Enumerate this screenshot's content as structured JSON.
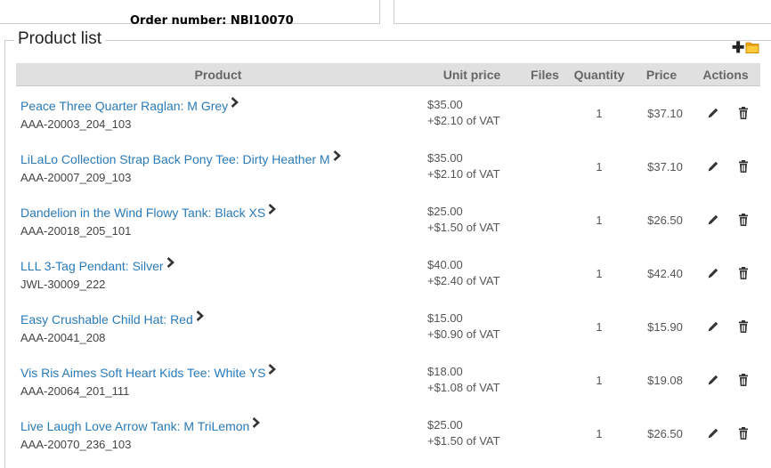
{
  "order": {
    "number_label": "Order number: NBI10070"
  },
  "section": {
    "legend": "Product list"
  },
  "toolbar": {
    "add_icon": "plus-icon",
    "folder_icon": "folder-icon",
    "folder_color": "#f0a800"
  },
  "table": {
    "headers": {
      "product": "Product",
      "unit_price": "Unit price",
      "files": "Files",
      "quantity": "Quantity",
      "price": "Price",
      "actions": "Actions"
    },
    "rows": [
      {
        "name": "Peace Three Quarter Raglan: M Grey",
        "sku": "AAA-20003_204_103",
        "unit_price": "$35.00",
        "vat": "+$2.10 of VAT",
        "quantity": "1",
        "price": "$37.10"
      },
      {
        "name": "LiLaLo Collection Strap Back Pony Tee: Dirty Heather M",
        "sku": "AAA-20007_209_103",
        "unit_price": "$35.00",
        "vat": "+$2.10 of VAT",
        "quantity": "1",
        "price": "$37.10"
      },
      {
        "name": "Dandelion in the Wind Flowy Tank: Black XS",
        "sku": "AAA-20018_205_101",
        "unit_price": "$25.00",
        "vat": "+$1.50 of VAT",
        "quantity": "1",
        "price": "$26.50"
      },
      {
        "name": "LLL 3-Tag Pendant: Silver",
        "sku": "JWL-30009_222",
        "unit_price": "$40.00",
        "vat": "+$2.40 of VAT",
        "quantity": "1",
        "price": "$42.40"
      },
      {
        "name": "Easy Crushable Child Hat: Red",
        "sku": "AAA-20041_208",
        "unit_price": "$15.00",
        "vat": "+$0.90 of VAT",
        "quantity": "1",
        "price": "$15.90"
      },
      {
        "name": "Vis Ris Aimes Soft Heart Kids Tee: White YS",
        "sku": "AAA-20064_201_111",
        "unit_price": "$18.00",
        "vat": "+$1.08 of VAT",
        "quantity": "1",
        "price": "$19.08"
      },
      {
        "name": "Live Laugh Love Arrow Tank: M TriLemon",
        "sku": "AAA-20070_236_103",
        "unit_price": "$25.00",
        "vat": "+$1.50 of VAT",
        "quantity": "1",
        "price": "$26.50"
      }
    ],
    "row_icons": {
      "link": "chevron-right-icon",
      "edit": "pencil-icon",
      "delete": "trash-icon"
    }
  },
  "colors": {
    "link": "#2a7ab8",
    "header_bg": "#e0e0e0"
  }
}
